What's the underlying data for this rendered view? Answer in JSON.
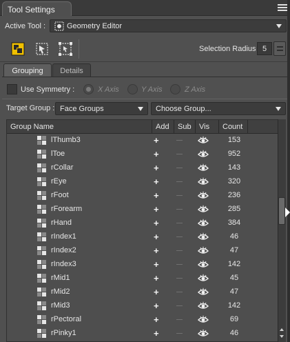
{
  "panel": {
    "title": "Tool Settings",
    "menu_icon": "panel-menu-icon"
  },
  "active_tool": {
    "label": "Active Tool :",
    "value": "Geometry Editor"
  },
  "toolbar": {
    "tools": [
      "geometry-editor-tool-icon",
      "geometry-select-tool-icon",
      "geometry-bounds-tool-icon"
    ],
    "selection_radius_label": "Selection Radius :",
    "selection_radius_value": "5"
  },
  "tabs": [
    {
      "label": "Grouping",
      "active": true
    },
    {
      "label": "Details",
      "active": false
    }
  ],
  "symmetry": {
    "label": "Use Symmetry :",
    "checked": false,
    "axes": [
      {
        "label": "X Axis",
        "selected": true
      },
      {
        "label": "Y Axis",
        "selected": false
      },
      {
        "label": "Z Axis",
        "selected": false
      }
    ]
  },
  "target_group": {
    "label": "Target Group :",
    "value": "Face Groups",
    "choose_value": "Choose Group..."
  },
  "table": {
    "headers": [
      "Group Name",
      "Add",
      "Sub",
      "Vis",
      "Count"
    ],
    "rows": [
      {
        "name": "lThumb3",
        "count": "153"
      },
      {
        "name": "lToe",
        "count": "952"
      },
      {
        "name": "rCollar",
        "count": "143"
      },
      {
        "name": "rEye",
        "count": "320"
      },
      {
        "name": "rFoot",
        "count": "236"
      },
      {
        "name": "rForearm",
        "count": "285"
      },
      {
        "name": "rHand",
        "count": "384"
      },
      {
        "name": "rIndex1",
        "count": "46"
      },
      {
        "name": "rIndex2",
        "count": "47"
      },
      {
        "name": "rIndex3",
        "count": "142"
      },
      {
        "name": "rMid1",
        "count": "45"
      },
      {
        "name": "rMid2",
        "count": "47"
      },
      {
        "name": "rMid3",
        "count": "142"
      },
      {
        "name": "rPectoral",
        "count": "69"
      },
      {
        "name": "rPinky1",
        "count": "46"
      }
    ]
  },
  "colors": {
    "accent_yellow": "#f0c000",
    "background": "#505050"
  }
}
